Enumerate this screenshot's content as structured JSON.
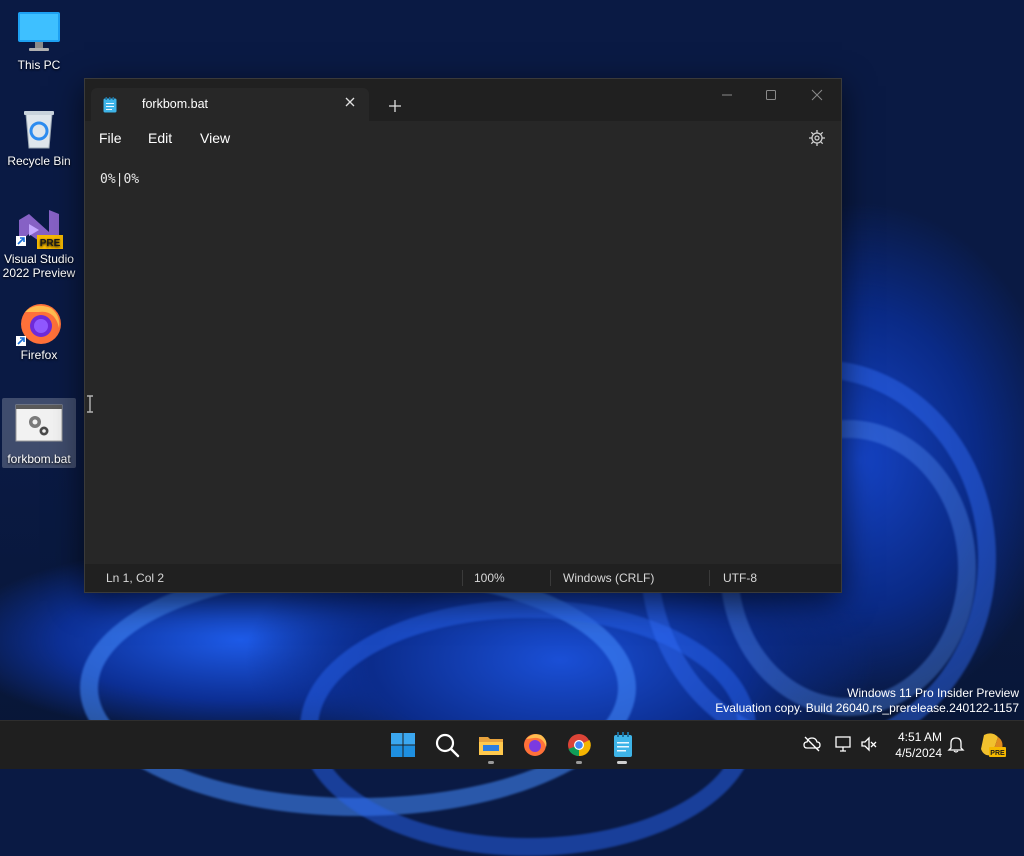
{
  "desktop": {
    "icons": [
      {
        "label": "This PC"
      },
      {
        "label": "Recycle Bin"
      },
      {
        "label": "Visual Studio 2022 Preview",
        "badge": "PRE"
      },
      {
        "label": "Firefox"
      },
      {
        "label": "forkbom.bat"
      }
    ]
  },
  "notepad": {
    "tab_title": "forkbom.bat",
    "menu": [
      "File",
      "Edit",
      "View"
    ],
    "content": "0%|0%",
    "status": {
      "position": "Ln 1, Col 2",
      "zoom": "100%",
      "line_ending": "Windows (CRLF)",
      "encoding": "UTF-8"
    }
  },
  "watermark": {
    "line1": "Windows 11 Pro Insider Preview",
    "line2": "Evaluation copy. Build 26040.rs_prerelease.240122-1157"
  },
  "taskbar": {
    "apps": [
      "start-icon",
      "search-icon",
      "file-explorer-icon",
      "firefox-icon",
      "chrome-icon",
      "notepad-icon"
    ],
    "time": "4:51 AM",
    "date": "4/5/2024",
    "copilot_badge": "PRE"
  },
  "colors": {
    "window_bg": "#272727",
    "titlebar_bg": "#202020",
    "taskbar_bg": "#1f1f1f",
    "accent": "#0078d4"
  }
}
